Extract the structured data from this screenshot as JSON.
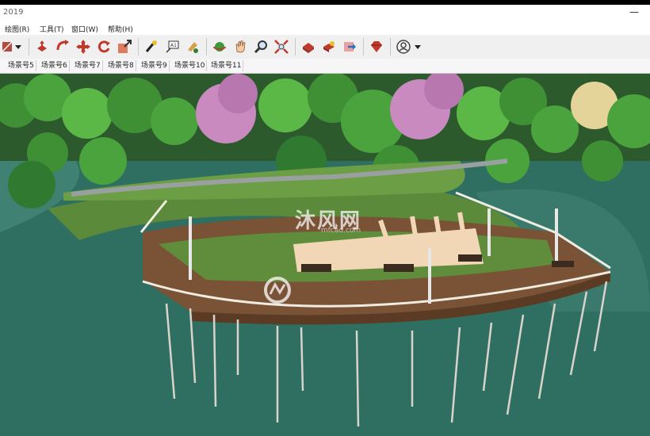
{
  "app": {
    "title": "2019"
  },
  "menu": {
    "items": [
      "绘图(R)",
      "工具(T)",
      "窗口(W)",
      "帮助(H)"
    ]
  },
  "toolbar": {
    "buttons": [
      "paint-bucket-icon",
      "dropdown-arrow-icon",
      "push-pull-icon",
      "follow-me-icon",
      "move-icon",
      "rotate-icon",
      "scale-icon",
      "tape-measure-icon",
      "text-label-icon",
      "paint-tool-icon",
      "orbit-icon",
      "pan-icon",
      "zoom-icon",
      "zoom-extents-icon",
      "warehouse-icon",
      "extension-icon",
      "share-model-icon",
      "ruby-icon",
      "account-icon",
      "account-dropdown-icon"
    ]
  },
  "scenes": {
    "tabs": [
      "场景号5",
      "场景号6",
      "场景号7",
      "场景号8",
      "场景号9",
      "场景号10",
      "场景号11"
    ]
  },
  "watermark": {
    "text": "沐风网",
    "sub": "mfcad.com"
  },
  "colors": {
    "water": "#2f6f62",
    "deck": "#7a5236",
    "railing": "#f0ece2",
    "tree": "#4aa33c",
    "blossom": "#c98ac0"
  }
}
